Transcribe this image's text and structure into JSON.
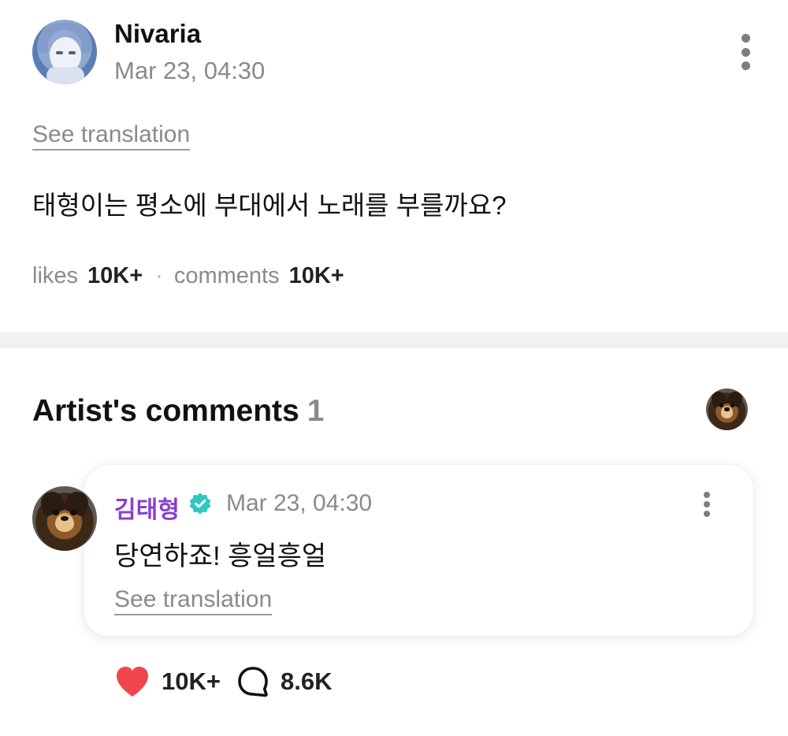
{
  "post": {
    "author": "Nivaria",
    "timestamp": "Mar 23, 04:30",
    "translate_label": "See translation",
    "body": "태형이는 평소에 부대에서 노래를 부를까요?",
    "stats": {
      "likes_label": "likes",
      "likes_value": "10K+",
      "separator": "·",
      "comments_label": "comments",
      "comments_value": "10K+"
    }
  },
  "artist_comments": {
    "title": "Artist's comments",
    "count": "1",
    "comment": {
      "author": "김태형",
      "verified": true,
      "timestamp": "Mar 23, 04:30",
      "body": "당연하죠! 흥얼흥얼",
      "translate_label": "See translation",
      "likes": "10K+",
      "replies": "8.6K"
    }
  },
  "colors": {
    "artist_name": "#8a3fd0",
    "verified_badge": "#2fc7c2",
    "heart": "#f0454f",
    "muted_text": "#8a8a8e"
  },
  "icons": {
    "post_menu": "more-vertical-icon",
    "comment_menu": "more-vertical-icon",
    "verified": "verified-badge-icon",
    "like": "heart-icon",
    "reply": "speech-bubble-icon"
  }
}
